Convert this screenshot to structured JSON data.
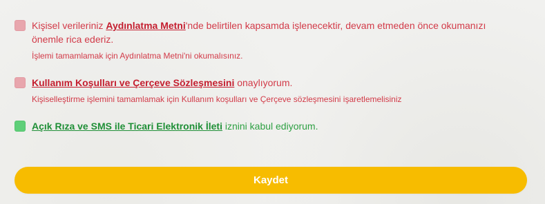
{
  "consents": {
    "kvkk": {
      "prefix": "Kişisel verileriniz ",
      "link": "Aydınlatma Metni",
      "suffix_line1": "'nde belirtilen kapsamda işlenecektir, devam etmeden önce okumanızı",
      "suffix_line2": "önemle rica ederiz.",
      "error": "İşlemi tamamlamak için Aydınlatma Metni'ni okumalısınız."
    },
    "terms": {
      "link": "Kullanım Koşulları ve Çerçeve Sözleşmesini",
      "suffix": " onaylıyorum.",
      "error": "Kişiselleştirme işlemini tamamlamak için Kullanım koşulları ve Çerçeve sözleşmesini işaretlemelisiniz"
    },
    "marketing": {
      "link": "Açık Rıza ve SMS ile Ticari Elektronik İleti",
      "suffix": " iznini kabul ediyorum."
    }
  },
  "actions": {
    "save_label": "Kaydet"
  },
  "colors": {
    "error": "#d23a48",
    "success": "#2ea043",
    "button": "#f7bc00"
  }
}
